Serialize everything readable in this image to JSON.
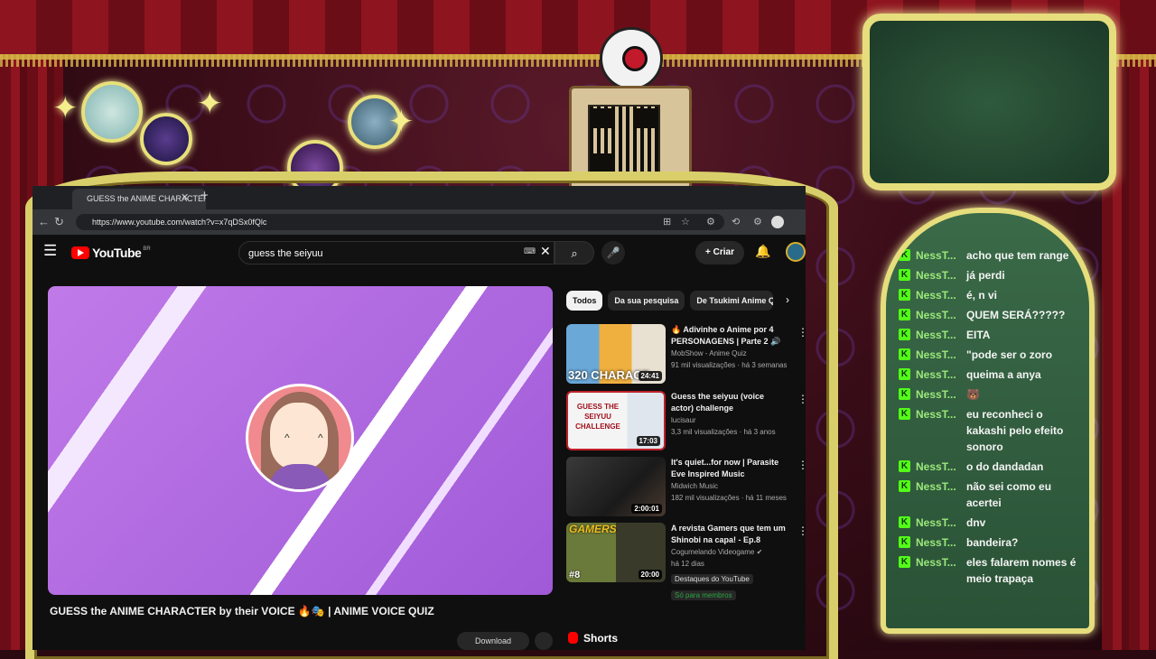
{
  "browser": {
    "tab_title": "GUESS the ANIME CHARACTER",
    "url": "https://www.youtube.com/watch?v=x7qDSx0fQlc"
  },
  "youtube": {
    "logo_text": "YouTube",
    "region": "BR",
    "search_value": "guess the seiyuu",
    "create_label": "Criar",
    "video_title": "GUESS the ANIME CHARACTER by their VOICE 🔥🎭 | ANIME VOICE QUIZ",
    "download_label": "Download",
    "chips": [
      "Todos",
      "Da sua pesquisa",
      "De Tsukimi Anime Q"
    ],
    "shorts_label": "Shorts",
    "recommendations": [
      {
        "title": "🔥 Adivinhe o Anime por 4 PERSONAGENS | Parte 2 🔊",
        "channel": "MobShow - Anime Quiz",
        "meta": "91 mil visualizações · há 3 semanas",
        "duration": "24:41",
        "thumb_text": "320 CHARACT"
      },
      {
        "title": "Guess the seiyuu (voice actor) challenge",
        "channel": "lucisaur",
        "meta": "3,3 mil visualizações · há 3 anos",
        "duration": "17:03",
        "thumb_text": "GUESS THE SEIYUU CHALLENGE"
      },
      {
        "title": "It's quiet...for now | Parasite Eve Inspired Music",
        "channel": "Midwich Music",
        "meta": "182 mil visualizações · há 11 meses",
        "duration": "2:00:01",
        "thumb_text": ""
      },
      {
        "title": "A revista Gamers que tem um Shinobi na capa! - Ep.8",
        "channel": "Cogumelando Videogame ✔",
        "meta": "há 12 dias",
        "duration": "20:00",
        "thumb_text": "GAMERS",
        "thumb_num": "#8",
        "badge1": "Destaques do YouTube",
        "badge2": "Só para membros"
      }
    ]
  },
  "chat": {
    "kick_icon": "K",
    "messages": [
      {
        "user": "NessT...",
        "text": "acho que tem range"
      },
      {
        "user": "NessT...",
        "text": "já perdi"
      },
      {
        "user": "NessT...",
        "text": "é, n vi"
      },
      {
        "user": "NessT...",
        "text": "QUEM SERÁ?????"
      },
      {
        "user": "NessT...",
        "text": "EITA"
      },
      {
        "user": "NessT...",
        "text": "\"pode ser o zoro"
      },
      {
        "user": "NessT...",
        "text": "queima a anya"
      },
      {
        "user": "NessT...",
        "text": "🐻"
      },
      {
        "user": "NessT...",
        "text": "eu reconheci o kakashi pelo efeito sonoro"
      },
      {
        "user": "NessT...",
        "text": "o do dandadan"
      },
      {
        "user": "NessT...",
        "text": "não sei como eu acertei"
      },
      {
        "user": "NessT...",
        "text": "dnv"
      },
      {
        "user": "NessT...",
        "text": "bandeira?"
      },
      {
        "user": "NessT...",
        "text": "eles falarem nomes é meio trapaça"
      }
    ]
  },
  "colors": {
    "frame_gold": "#e6de7c",
    "youtube_red": "#ff0000",
    "kick_green": "#53fc18",
    "player_purple": "#b070e0"
  }
}
